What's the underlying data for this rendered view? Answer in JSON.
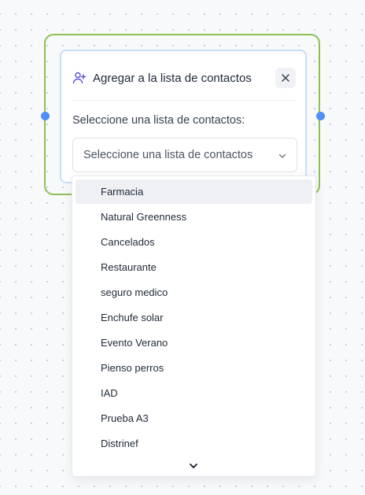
{
  "node": {
    "title": "Agregar a la lista de contactos",
    "field_label": "Seleccione una lista de contactos:",
    "select_placeholder": "Seleccione una lista de contactos",
    "icons": {
      "header": "user-plus-icon",
      "close": "close-icon",
      "select": "chevron-down-icon"
    }
  },
  "dropdown": {
    "options": [
      "Farmacia",
      "Natural Greenness",
      "Cancelados",
      "Restaurante",
      "seguro medico",
      "Enchufe solar",
      "Evento Verano",
      "Pienso perros",
      "IAD",
      "Prueba A3",
      "Distrinef"
    ],
    "highlighted_index": 0,
    "scroll_icon": "chevron-down-icon"
  },
  "colors": {
    "node_outline": "#8cc152",
    "handle": "#4f8ff7",
    "card_border": "#c9ddf7",
    "icon_accent": "#5b4fd6",
    "highlight_bg": "#eef0f4"
  }
}
